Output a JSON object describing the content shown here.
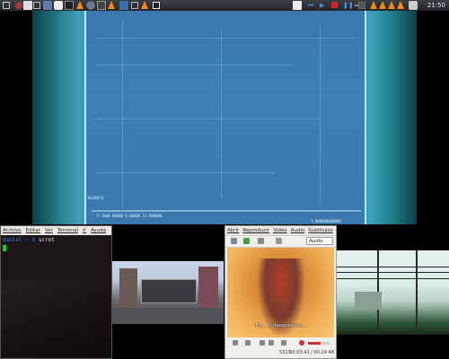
{
  "panel": {
    "clock": "21:50",
    "launchers": [
      "home-folder-icon",
      "gimp-icon",
      "browser-icon",
      "terminal-icon",
      "vlc-icon",
      "vlc-icon",
      "window-icon",
      "vlc-icon"
    ],
    "media": [
      "previous-icon",
      "play-icon",
      "stop-icon",
      "pause-icon",
      "next-icon"
    ],
    "colors": {
      "accent": "#f08a1a",
      "panel": "#2e3236"
    }
  },
  "main_video": {
    "hud_label_left": "Bo28874",
    "hud_label_bottom": "9-2000-00000 0-00000 11-000000",
    "hud_label_right": "1-000000000000"
  },
  "terminal": {
    "menu": [
      "Archivo",
      "Editar",
      "Ver",
      "Terminal",
      "Ir",
      "Ayuda"
    ],
    "prompt_user": "daniel",
    "prompt_path": "~",
    "prompt_symbol": "$",
    "command": "scrot"
  },
  "player": {
    "menu": [
      "Abrir",
      "Reproducir",
      "Vídeo",
      "Audio",
      "Subtítulos"
    ],
    "audio_select": "Audio",
    "subtitle": "Ea... Yo desaparezco...",
    "frame_count": "5313",
    "time": "00:03:41 / 00:24:48"
  }
}
